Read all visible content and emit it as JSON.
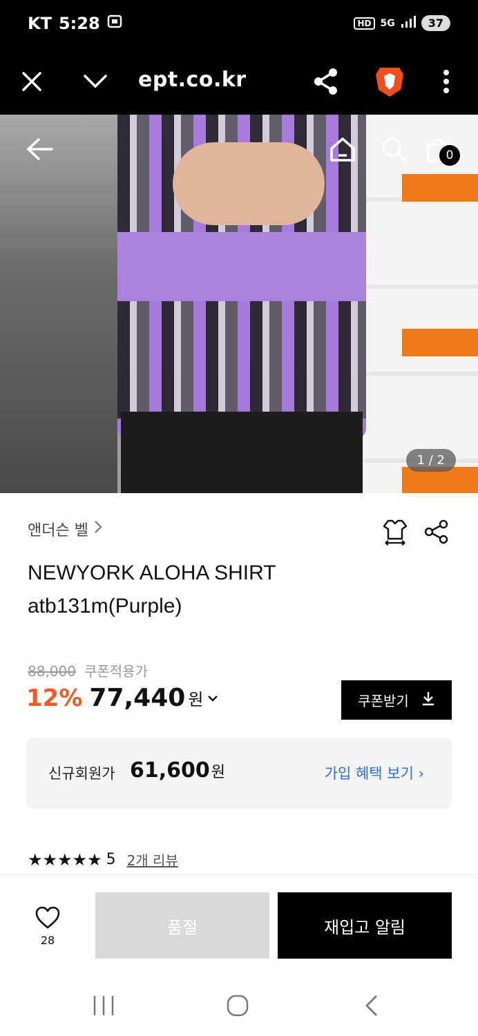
{
  "status_bar": {
    "carrier": "KT",
    "time": "5:28",
    "hd": "HD",
    "network": "5G",
    "battery": "37"
  },
  "browser": {
    "url": "ept.co.kr"
  },
  "gallery": {
    "cart_count": "0",
    "pager": "1 / 2"
  },
  "product": {
    "brand": "앤더슨 벨",
    "title_line1": "NEWYORK ALOHA SHIRT",
    "title_line2": "atb131m(Purple)",
    "original_price": "88,000",
    "coupon_label": "쿠폰적용가",
    "discount": "12%",
    "price": "77,440",
    "won": "원",
    "coupon_button": "쿠폰받기"
  },
  "member": {
    "label": "신규회원가",
    "price": "61,600",
    "won": "원",
    "link": "가입 혜택 보기 ›"
  },
  "rating": {
    "stars": "★★★★★",
    "score": "5",
    "reviews": "2개 리뷰"
  },
  "actions": {
    "likes": "28",
    "soldout": "품절",
    "restock": "재입고 알림"
  },
  "colors": {
    "discount": "#f15a24",
    "link": "#2d6fd2",
    "dark": "#000000"
  }
}
